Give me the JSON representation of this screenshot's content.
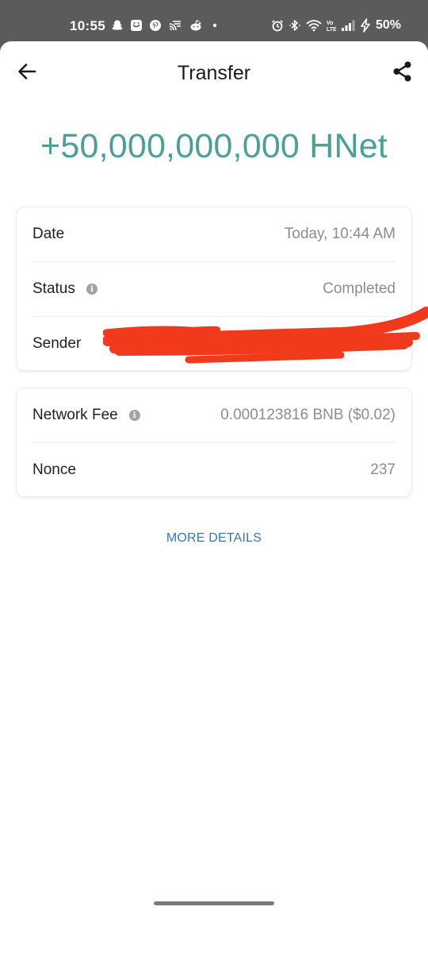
{
  "status_bar": {
    "time": "10:55",
    "battery": "50%",
    "notification_icons": [
      "snapchat-icon",
      "messages-icon",
      "pinterest-icon",
      "cast-icon",
      "reddit-icon",
      "more-dot-icon"
    ],
    "system_icons": [
      "alarm-icon",
      "bluetooth-icon",
      "wifi-icon",
      "lte-icon",
      "signal-icon",
      "charging-icon"
    ]
  },
  "header": {
    "title": "Transfer",
    "back_icon": "arrow-left-icon",
    "share_icon": "share-icon"
  },
  "amount": "+50,000,000,000 HNet",
  "details_card": {
    "rows": [
      {
        "label": "Date",
        "value": "Today, 10:44 AM"
      },
      {
        "label": "Status",
        "value": "Completed"
      },
      {
        "label": "Sender",
        "value": ""
      }
    ]
  },
  "fee_card": {
    "rows": [
      {
        "label": "Network Fee",
        "value": "0.000123816 BNB ($0.02)"
      },
      {
        "label": "Nonce",
        "value": "237"
      }
    ]
  },
  "more_details_label": "MORE DETAILS",
  "colors": {
    "amount": "#4c9f96",
    "link": "#3a77a6",
    "redaction": "#f1391b",
    "status_bar": "#5b5b5b"
  }
}
